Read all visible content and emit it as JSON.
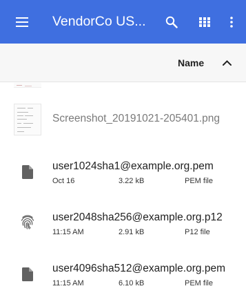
{
  "toolbar": {
    "title": "VendorCo US...",
    "menu_icon": "hamburger-menu-icon",
    "search_icon": "search-icon",
    "grid_icon": "grid-view-icon",
    "more_icon": "more-vert-icon",
    "background": "#3f6fe0"
  },
  "sort": {
    "label": "Name",
    "direction_icon": "chevron-up-icon"
  },
  "files": [
    {
      "name": "Screenshot_20191021-205401.png",
      "icon": "image-thumbnail",
      "date": "",
      "size": "",
      "type": ""
    },
    {
      "name": "user1024sha1@example.org.pem",
      "icon": "file-icon",
      "date": "Oct 16",
      "size": "3.22 kB",
      "type": "PEM file"
    },
    {
      "name": "user2048sha256@example.org.p12",
      "icon": "fingerprint-icon",
      "date": "11:15 AM",
      "size": "2.91 kB",
      "type": "P12 file"
    },
    {
      "name": "user4096sha512@example.org.pem",
      "icon": "file-icon",
      "date": "11:15 AM",
      "size": "6.10 kB",
      "type": "PEM file"
    }
  ]
}
